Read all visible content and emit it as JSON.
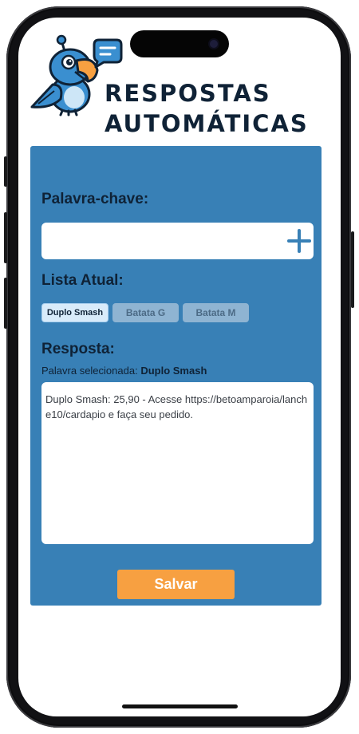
{
  "app": {
    "title_line1": "Respostas",
    "title_line2": "Automáticas"
  },
  "form": {
    "keyword_label": "Palavra-chave:",
    "keyword_value": "",
    "add_icon": "plus-icon",
    "list_label": "Lista Atual:",
    "keywords": [
      {
        "label": "Duplo Smash",
        "selected": true
      },
      {
        "label": "Batata G",
        "selected": false
      },
      {
        "label": "Batata M",
        "selected": false
      }
    ],
    "response_label": "Resposta:",
    "selected_prefix": "Palavra selecionada:",
    "selected_keyword": "Duplo Smash",
    "response_text": "Duplo Smash: 25,90 - Acesse https://betoamparoia/lanche10/cardapio e faça seu pedido.",
    "save_label": "Salvar"
  },
  "colors": {
    "panel": "#3880b6",
    "title": "#0f2236",
    "save_button": "#f7a041",
    "chip_active": "#d8ebfa",
    "chip_inactive": "#8fb4d2"
  }
}
